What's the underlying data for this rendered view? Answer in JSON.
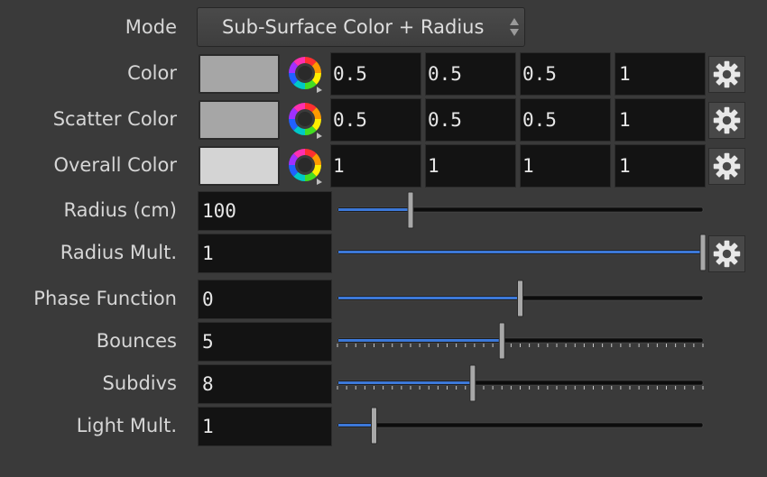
{
  "mode": {
    "label": "Mode",
    "value": "Sub-Surface Color + Radius"
  },
  "colors": [
    {
      "label": "Color",
      "swatch": "#a6a6a6",
      "r": "0.5",
      "g": "0.5",
      "b": "0.5",
      "a": "1"
    },
    {
      "label": "Scatter Color",
      "swatch": "#a6a6a6",
      "r": "0.5",
      "g": "0.5",
      "b": "0.5",
      "a": "1"
    },
    {
      "label": "Overall Color",
      "swatch": "#d4d4d4",
      "r": "1",
      "g": "1",
      "b": "1",
      "a": "1"
    }
  ],
  "params": [
    {
      "label": "Radius (cm)",
      "value": "100",
      "level": 0.2,
      "ticks": false,
      "gear": false
    },
    {
      "label": "Radius Mult.",
      "value": "1",
      "level": 1.0,
      "ticks": false,
      "gear": true
    },
    {
      "label": "Phase Function",
      "value": "0",
      "level": 0.5,
      "ticks": false,
      "gear": false
    },
    {
      "label": "Bounces",
      "value": "5",
      "level": 0.45,
      "ticks": true,
      "gear": false
    },
    {
      "label": "Subdivs",
      "value": "8",
      "level": 0.37,
      "ticks": true,
      "gear": false
    },
    {
      "label": "Light Mult.",
      "value": "1",
      "level": 0.1,
      "ticks": false,
      "gear": false
    }
  ],
  "colors_theme": {
    "slider_fill": "#3c78d8",
    "field_bg": "#131313"
  }
}
